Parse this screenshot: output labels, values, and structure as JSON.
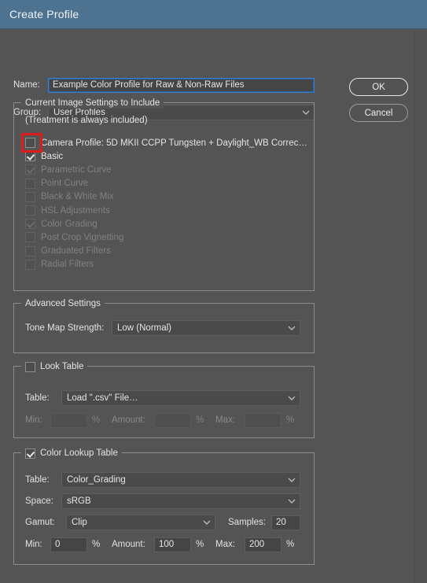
{
  "window": {
    "title": "Create Profile"
  },
  "form": {
    "name_label": "Name:",
    "name_value": "Example Color Profile for Raw & Non-Raw Files",
    "group_label": "Group:",
    "group_value": "User Profiles"
  },
  "buttons": {
    "ok": "OK",
    "cancel": "Cancel"
  },
  "current_image_settings": {
    "legend": "Current Image Settings to Include",
    "note": "(Treatment is always included)",
    "items": [
      {
        "label": "Camera Profile: 5D MKII CCPP Tungsten + Daylight_WB Correc…",
        "checked": false,
        "enabled": true,
        "highlighted": true
      },
      {
        "label": "Basic",
        "checked": true,
        "enabled": true,
        "highlighted": false
      },
      {
        "label": "Parametric Curve",
        "checked": true,
        "enabled": false,
        "highlighted": false
      },
      {
        "label": "Point Curve",
        "checked": false,
        "enabled": false,
        "highlighted": false
      },
      {
        "label": "Black & White Mix",
        "checked": false,
        "enabled": false,
        "highlighted": false
      },
      {
        "label": "HSL Adjustments",
        "checked": false,
        "enabled": false,
        "highlighted": false
      },
      {
        "label": "Color Grading",
        "checked": true,
        "enabled": false,
        "highlighted": false
      },
      {
        "label": "Post Crop Vignetting",
        "checked": false,
        "enabled": false,
        "highlighted": false
      },
      {
        "label": "Graduated Filters",
        "checked": false,
        "enabled": false,
        "highlighted": false
      },
      {
        "label": "Radial Filters",
        "checked": false,
        "enabled": false,
        "highlighted": false
      }
    ]
  },
  "advanced_settings": {
    "legend": "Advanced Settings",
    "tone_map_label": "Tone Map Strength:",
    "tone_map_value": "Low (Normal)"
  },
  "look_table": {
    "legend": "Look Table",
    "checked": false,
    "table_label": "Table:",
    "table_value": "Load \".csv\" File…",
    "min_label": "Min:",
    "min_value": "",
    "amount_label": "Amount:",
    "amount_value": "",
    "max_label": "Max:",
    "max_value": "",
    "percent": "%"
  },
  "color_lookup_table": {
    "legend": "Color Lookup Table",
    "checked": true,
    "table_label": "Table:",
    "table_value": "Color_Grading",
    "space_label": "Space:",
    "space_value": "sRGB",
    "gamut_label": "Gamut:",
    "gamut_value": "Clip",
    "samples_label": "Samples:",
    "samples_value": "20",
    "min_label": "Min:",
    "min_value": "0",
    "amount_label": "Amount:",
    "amount_value": "100",
    "max_label": "Max:",
    "max_value": "200",
    "percent": "%"
  },
  "annotation": {
    "color": "#e01b1b"
  },
  "colors": {
    "titlebar": "#4e7391",
    "dialog_bg": "#545454",
    "accent_focus": "#3a7fd0"
  }
}
